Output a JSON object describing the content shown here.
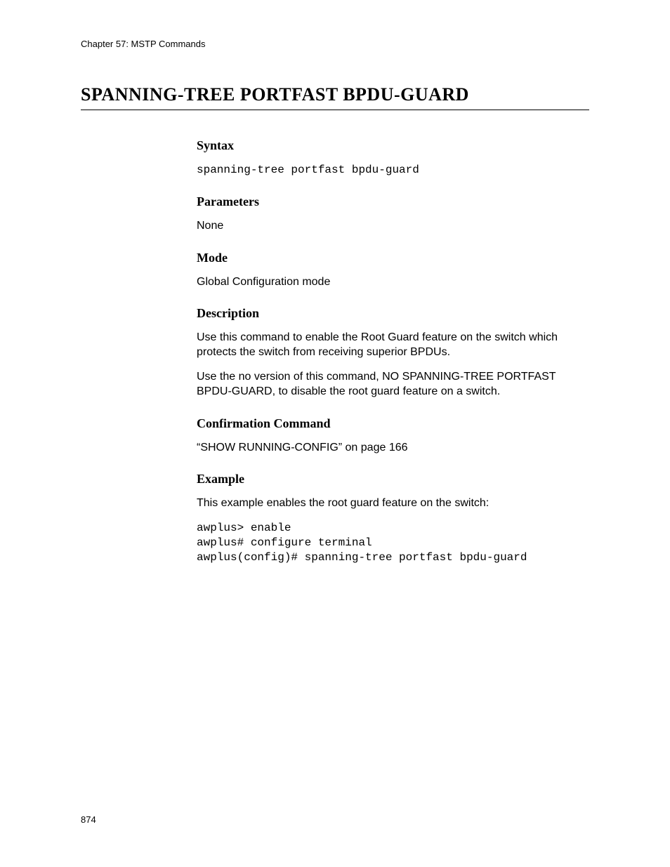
{
  "header": {
    "chapter": "Chapter 57: MSTP Commands"
  },
  "title": "SPANNING-TREE PORTFAST BPDU-GUARD",
  "sections": {
    "syntax": {
      "heading": "Syntax",
      "code": "spanning-tree portfast bpdu-guard"
    },
    "parameters": {
      "heading": "Parameters",
      "body": "None"
    },
    "mode": {
      "heading": "Mode",
      "body": "Global Configuration mode"
    },
    "description": {
      "heading": "Description",
      "p1": "Use this command to enable the Root Guard feature on the switch which protects the switch from receiving superior BPDUs.",
      "p2": "Use the no version of this command, NO SPANNING-TREE PORTFAST BPDU-GUARD, to disable the root guard feature on a switch."
    },
    "confirmation": {
      "heading": "Confirmation Command",
      "body": "“SHOW RUNNING-CONFIG” on page 166"
    },
    "example": {
      "heading": "Example",
      "intro": "This example enables the root guard feature on the switch:",
      "code": "awplus> enable\nawplus# configure terminal\nawplus(config)# spanning-tree portfast bpdu-guard"
    }
  },
  "footer": {
    "page_number": "874"
  }
}
